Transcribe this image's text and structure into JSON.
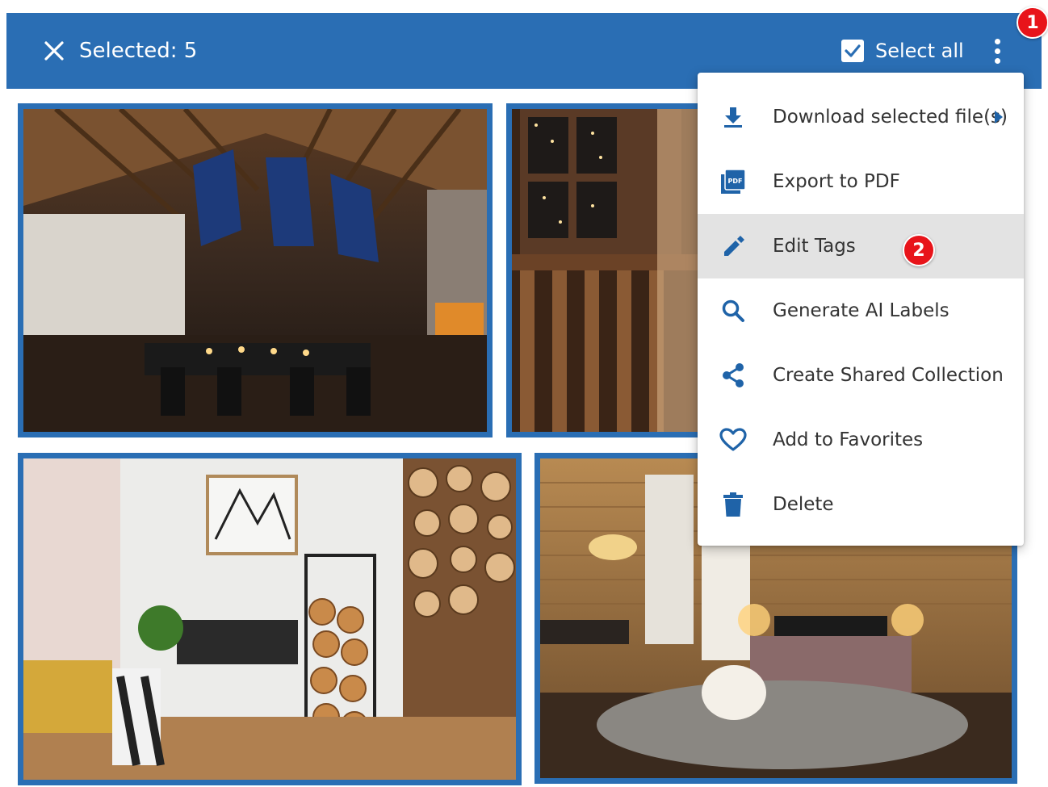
{
  "toolbar": {
    "selected_label": "Selected: 5",
    "select_all_label": "Select all",
    "select_all_checked": true,
    "close_icon": "close-icon",
    "more_icon": "more-vert-icon",
    "background_color": "#2a6eb4"
  },
  "annotations": {
    "step1": "1",
    "step2": "2",
    "color": "#e8141a"
  },
  "menu": {
    "items": [
      {
        "label": "Download selected file(s)",
        "icon": "download-icon",
        "has_submenu": true
      },
      {
        "label": "Export to PDF",
        "icon": "pdf-icon"
      },
      {
        "label": "Edit Tags",
        "icon": "pencil-icon",
        "highlighted": true
      },
      {
        "label": "Generate AI Labels",
        "icon": "search-icon"
      },
      {
        "label": "Create Shared Collection",
        "icon": "share-icon"
      },
      {
        "label": "Add to Favorites",
        "icon": "heart-icon"
      },
      {
        "label": "Delete",
        "icon": "trash-icon"
      }
    ],
    "accent_color": "#1f63a8"
  },
  "gallery": {
    "selected_count": 5,
    "tiles": [
      {
        "scene": "chalet-living-room-night",
        "selected": true
      },
      {
        "scene": "rustic-balcony-lights",
        "selected": true
      },
      {
        "scene": "scandinavian-living-room-firewood",
        "selected": true
      },
      {
        "scene": "log-cabin-bedroom",
        "selected": true
      }
    ]
  }
}
